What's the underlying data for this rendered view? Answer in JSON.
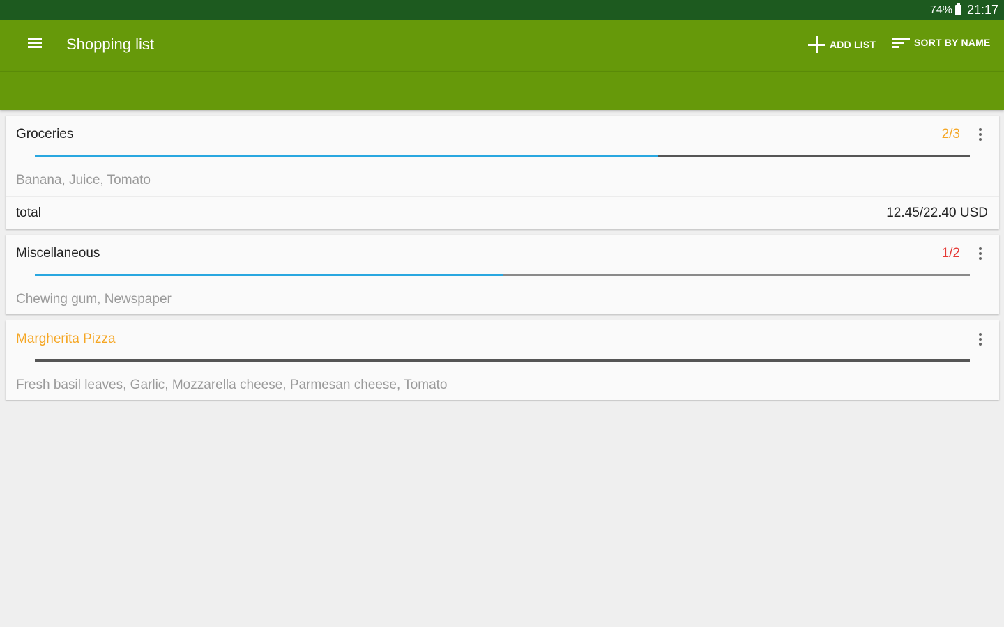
{
  "status_bar": {
    "battery": "74%",
    "time": "21:17"
  },
  "toolbar": {
    "title": "Shopping list",
    "add_list_label": "ADD LIST",
    "sort_label": "SORT BY NAME"
  },
  "icons": {
    "menu": "hamburger-menu-icon",
    "add": "plus-icon",
    "sort": "sort-icon",
    "more": "more-vert-icon",
    "battery": "battery-icon"
  },
  "colors": {
    "status_bar": "#1d5a1f",
    "toolbar": "#66990a",
    "progress": "#29a7e0",
    "count_partial": "#f5a623",
    "count_low": "#e53935",
    "empty_list_title": "#f5a623"
  },
  "lists": [
    {
      "name": "Groceries",
      "count": "2/3",
      "progress_fraction": 0.667,
      "items": "Banana, Juice, Tomato",
      "total_label": "total",
      "total_value": "12.45/22.40 USD"
    },
    {
      "name": "Miscellaneous",
      "count": "1/2",
      "progress_fraction": 0.5,
      "items": "Chewing gum, Newspaper"
    },
    {
      "name": "Margherita Pizza",
      "count": "",
      "progress_fraction": 0,
      "items": "Fresh basil leaves, Garlic, Mozzarella cheese, Parmesan cheese, Tomato"
    }
  ]
}
